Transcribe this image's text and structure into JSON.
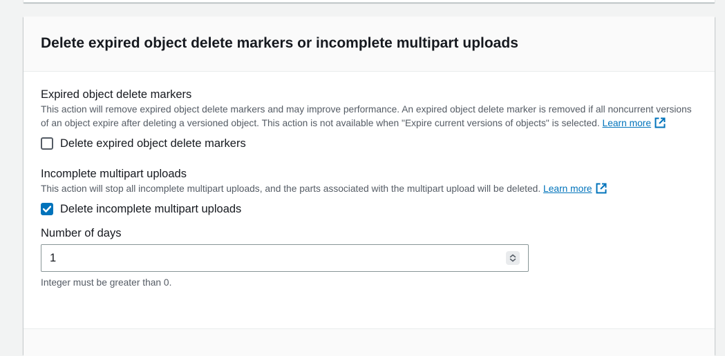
{
  "card": {
    "title": "Delete expired object delete markers or incomplete multipart uploads"
  },
  "expired_markers": {
    "label": "Expired object delete markers",
    "description": "This action will remove expired object delete markers and may improve performance. An expired object delete marker is removed if all noncurrent versions of an object expire after deleting a versioned object. This action is not available when \"Expire current versions of objects\" is selected.",
    "learn_more": "Learn more",
    "checkbox_label": "Delete expired object delete markers",
    "checked": false
  },
  "multipart": {
    "label": "Incomplete multipart uploads",
    "description": "This action will stop all incomplete multipart uploads, and the parts associated with the multipart upload will be deleted.",
    "learn_more": "Learn more",
    "checkbox_label": "Delete incomplete multipart uploads",
    "checked": true
  },
  "days_field": {
    "label": "Number of days",
    "value": "1",
    "hint": "Integer must be greater than 0."
  },
  "colors": {
    "link": "#0073bb",
    "checkbox_checked": "#0073bb",
    "text_primary": "#16191f",
    "text_secondary": "#545b64"
  },
  "icons": {
    "external_link": "external-link-icon",
    "checkmark": "checkmark-icon",
    "stepper": "number-stepper-icon"
  }
}
